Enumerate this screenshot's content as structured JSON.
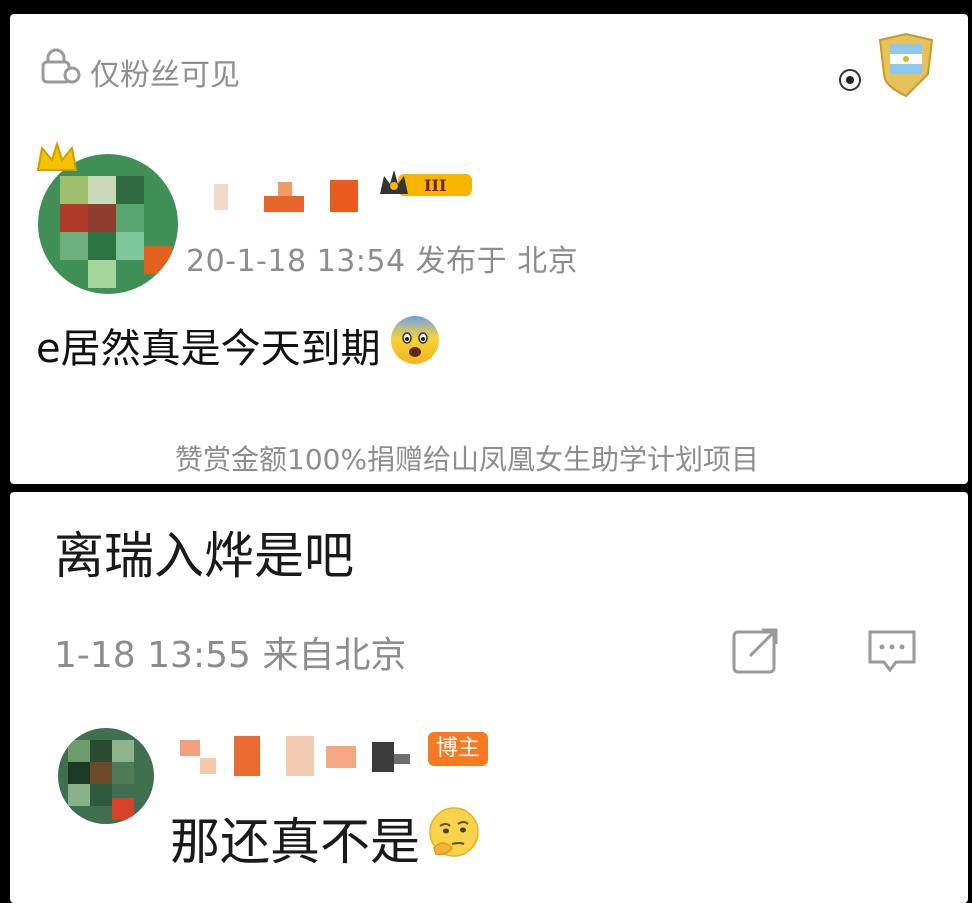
{
  "post": {
    "visibility_label": "仅粉丝可见",
    "visibility_icon": "lock-people-icon",
    "fan_badge_icon": "argentina-shield-badge-icon",
    "vip_level": "III",
    "meta": "20-1-18 13:54  发布于 北京",
    "text": "e居然真是今天到期",
    "emoji": "fearful-face-emoji",
    "donation_note": "赞赏金额100%捐赠给山凤凰女生助学计划项目"
  },
  "comment": {
    "text": "离瑞入烨是吧",
    "meta": "1-18 13:55  来自北京",
    "share_icon": "share-icon",
    "comment_icon": "comment-icon"
  },
  "reply": {
    "host_badge": "博主",
    "text": "那还真不是",
    "emoji": "thinking-face-emoji"
  },
  "colors": {
    "muted_text": "#8d8d8d",
    "host_badge": "#f57a20",
    "gold": "#f2b300"
  }
}
